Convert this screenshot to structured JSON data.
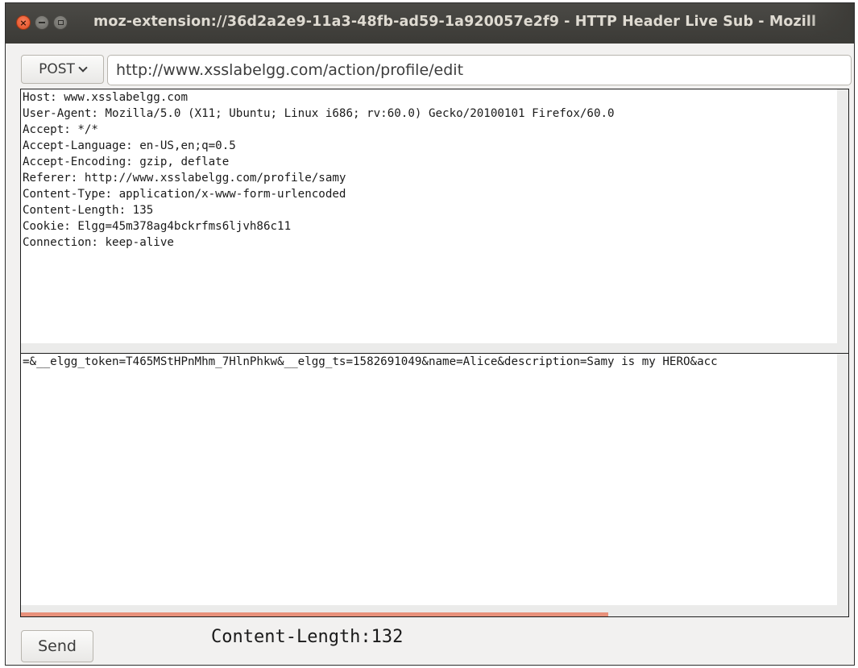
{
  "window": {
    "title": "moz-extension://36d2a2e9-11a3-48fb-ad59-1a920057e2f9 - HTTP Header Live Sub - Mozill"
  },
  "request": {
    "method": "POST",
    "url": "http://www.xsslabelgg.com/action/profile/edit"
  },
  "headers": [
    "Host: www.xsslabelgg.com",
    "User-Agent: Mozilla/5.0 (X11; Ubuntu; Linux i686; rv:60.0) Gecko/20100101 Firefox/60.0",
    "Accept: */*",
    "Accept-Language: en-US,en;q=0.5",
    "Accept-Encoding: gzip, deflate",
    "Referer: http://www.xsslabelgg.com/profile/samy",
    "Content-Type: application/x-www-form-urlencoded",
    "Content-Length: 135",
    "Cookie: Elgg=45m378ag4bckrfms6ljvh86c11",
    "Connection: keep-alive"
  ],
  "body_text": "=&__elgg_token=T465MStHPnMhm_7HlnPhkw&__elgg_ts=1582691049&name=Alice&description=Samy is my HERO&acc",
  "body_scroll_fraction": 0.71,
  "footer": {
    "send_label": "Send",
    "content_length_text": "Content-Length:132"
  },
  "colors": {
    "titlebar": "#3c3b37",
    "close_button": "#e95420",
    "scroll_indicator": "#e8917b"
  }
}
